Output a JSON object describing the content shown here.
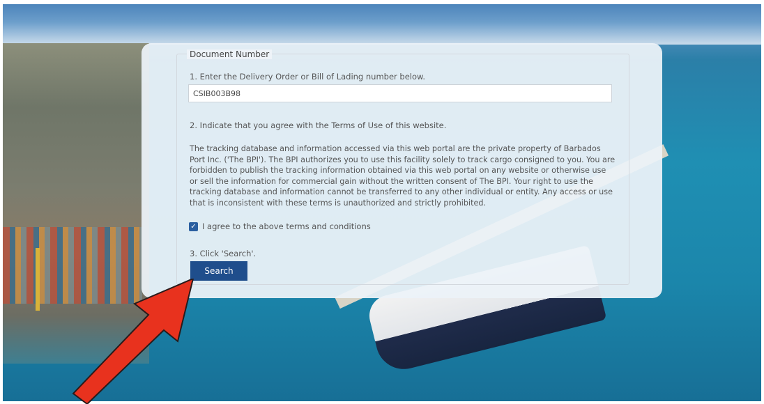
{
  "form": {
    "legend": "Document Number",
    "step1": "1. Enter the Delivery Order or Bill of Lading number below.",
    "document_number_value": "CSIB003B98",
    "step2": "2. Indicate that you agree with the Terms of Use of this website.",
    "terms_text": "The tracking database and information accessed via this web portal are the private property of Barbados Port Inc. ('The BPI'). The BPI authorizes you to use this facility solely to track cargo consigned to you. You are forbidden to publish the tracking information obtained via this web portal on any website or otherwise use or sell the information for commercial gain without the written consent of The BPI. Your right to use the tracking database and information cannot be transferred to any other individual or entity. Any access or use that is inconsistent with these terms is unauthorized and strictly prohibited.",
    "agree_label": "I agree to the above terms and conditions",
    "agree_checked": true,
    "step3": "3. Click 'Search'.",
    "search_label": "Search"
  },
  "colors": {
    "button": "#1f4e8c",
    "checkbox": "#2b5fa0",
    "arrow": "#e8321e"
  },
  "icons": {
    "checkbox_mark": "check-icon",
    "annotation": "red-arrow-icon"
  }
}
